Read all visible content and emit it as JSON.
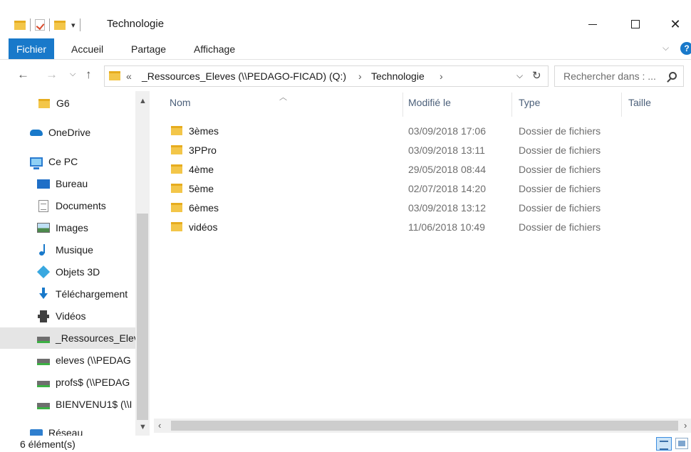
{
  "window": {
    "title": "Technologie"
  },
  "ribbon": {
    "tabs": [
      "Fichier",
      "Accueil",
      "Partage",
      "Affichage"
    ]
  },
  "address": {
    "overflow": "«",
    "segments": [
      "_Ressources_Eleves (\\\\PEDAGO-FICAD) (Q:)",
      "Technologie"
    ],
    "separator": "›"
  },
  "search": {
    "placeholder": "Rechercher dans : ..."
  },
  "nav_pane": {
    "items": [
      {
        "label": "G6",
        "icon": "folder-icon"
      },
      {
        "label": "OneDrive",
        "icon": "onedrive-icon"
      },
      {
        "label": "Ce PC",
        "icon": "computer-icon"
      },
      {
        "label": "Bureau",
        "icon": "desktop-icon"
      },
      {
        "label": "Documents",
        "icon": "documents-icon"
      },
      {
        "label": "Images",
        "icon": "pictures-icon"
      },
      {
        "label": "Musique",
        "icon": "music-icon"
      },
      {
        "label": "Objets 3D",
        "icon": "objects-3d-icon"
      },
      {
        "label": "Téléchargement",
        "icon": "download-icon"
      },
      {
        "label": "Vidéos",
        "icon": "videos-icon"
      },
      {
        "label": "_Ressources_Elev",
        "icon": "network-drive-icon",
        "selected": true
      },
      {
        "label": "eleves (\\\\PEDAG",
        "icon": "network-drive-icon"
      },
      {
        "label": "profs$ (\\\\PEDAG",
        "icon": "network-drive-icon"
      },
      {
        "label": "BIENVENU1$ (\\\\I",
        "icon": "network-drive-icon"
      },
      {
        "label": "Réseau",
        "icon": "network-icon"
      }
    ]
  },
  "columns": {
    "name": "Nom",
    "modified": "Modifié le",
    "type": "Type",
    "size": "Taille"
  },
  "files": [
    {
      "name": "3èmes",
      "modified": "03/09/2018 17:06",
      "type": "Dossier de fichiers"
    },
    {
      "name": "3PPro",
      "modified": "03/09/2018 13:11",
      "type": "Dossier de fichiers"
    },
    {
      "name": "4ème",
      "modified": "29/05/2018 08:44",
      "type": "Dossier de fichiers"
    },
    {
      "name": "5ème",
      "modified": "02/07/2018 14:20",
      "type": "Dossier de fichiers"
    },
    {
      "name": "6èmes",
      "modified": "03/09/2018 13:12",
      "type": "Dossier de fichiers"
    },
    {
      "name": "vidéos",
      "modified": "11/06/2018 10:49",
      "type": "Dossier de fichiers"
    }
  ],
  "status": {
    "count": "6 élément(s)"
  },
  "colors": {
    "accent": "#1979ca",
    "folder": "#f3c649",
    "selected_row": "#e5e5e5"
  }
}
